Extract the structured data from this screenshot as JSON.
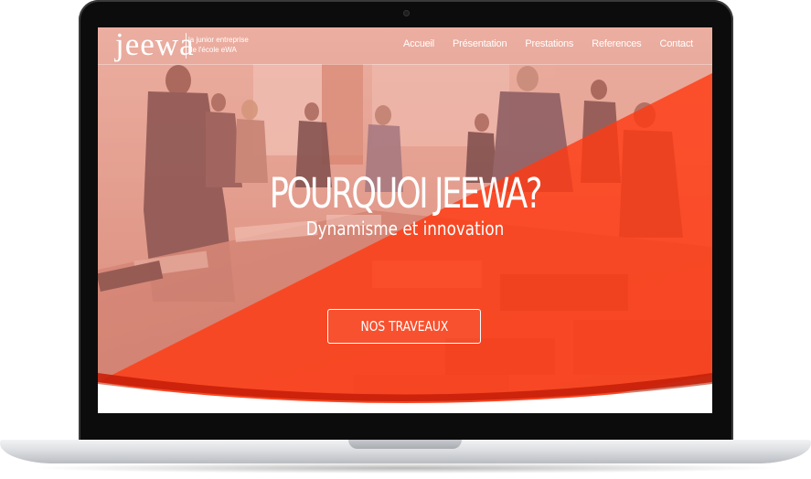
{
  "site": {
    "logo": "jeewa",
    "tagline_line1": "la junior entreprise",
    "tagline_line2": "de l'école eWA"
  },
  "nav": {
    "items": [
      {
        "label": "Accueil"
      },
      {
        "label": "Présentation"
      },
      {
        "label": "Prestations"
      },
      {
        "label": "References"
      },
      {
        "label": "Contact"
      }
    ]
  },
  "hero": {
    "title": "POURQUOI JEEWA?",
    "subtitle": "Dynamisme et innovation",
    "cta_label": "NOS TRAVEAUX"
  },
  "colors": {
    "accent_orange": "#ff3a14",
    "overlay_pink": "#f08a7c",
    "laptop_bezel": "#0c0c0c"
  }
}
